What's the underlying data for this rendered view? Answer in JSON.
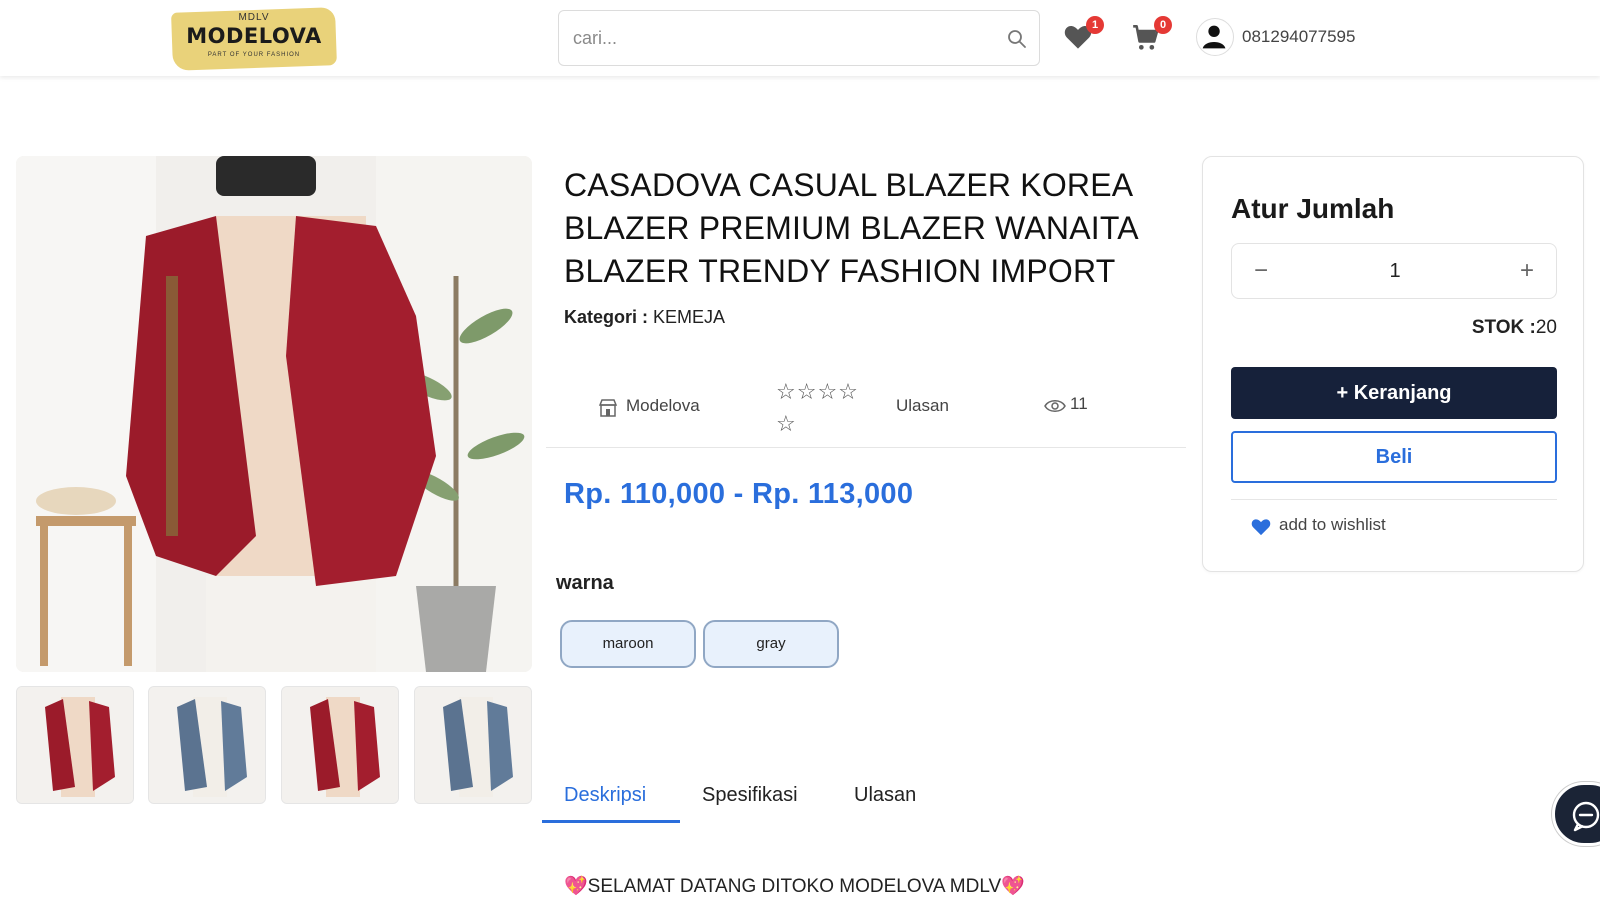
{
  "header": {
    "logo": {
      "top": "MDLV",
      "main": "MODELOVA",
      "sub": "PART OF YOUR FASHION"
    },
    "search_placeholder": "cari...",
    "wishlist_count": "1",
    "cart_count": "0",
    "phone": "081294077595"
  },
  "product": {
    "title": "CASADOVA CASUAL BLAZER KOREA BLAZER PREMIUM BLAZER WANAITA BLAZER TRENDY FASHION IMPORT",
    "category_label": "Kategori :",
    "category_value": "KEMEJA",
    "store": "Modelova",
    "review_label": "Ulasan",
    "views": "11",
    "stars": "☆☆☆☆ ☆",
    "price": "Rp. 110,000 - Rp. 113,000",
    "variant_label": "warna",
    "variants": [
      "maroon",
      "gray"
    ],
    "thumbnail_colors": [
      "maroon",
      "gray",
      "maroon",
      "gray"
    ]
  },
  "tabs": [
    "Deskripsi",
    "Spesifikasi",
    "Ulasan"
  ],
  "description": "💖SELAMAT DATANG DITOKO MODELOVA MDLV💖",
  "panel": {
    "title": "Atur Jumlah",
    "qty_minus": "−",
    "qty_value": "1",
    "qty_plus": "+",
    "stock_label": "STOK :",
    "stock_value": "20",
    "cart_button": "+ Keranjang",
    "buy_button": "Beli",
    "wishlist": "add to wishlist"
  },
  "colors": {
    "accent": "#2a6edc",
    "dark_button": "#16213a",
    "badge": "#e53935",
    "maroon": "#9b1b2a",
    "gray": "#5b7390"
  }
}
